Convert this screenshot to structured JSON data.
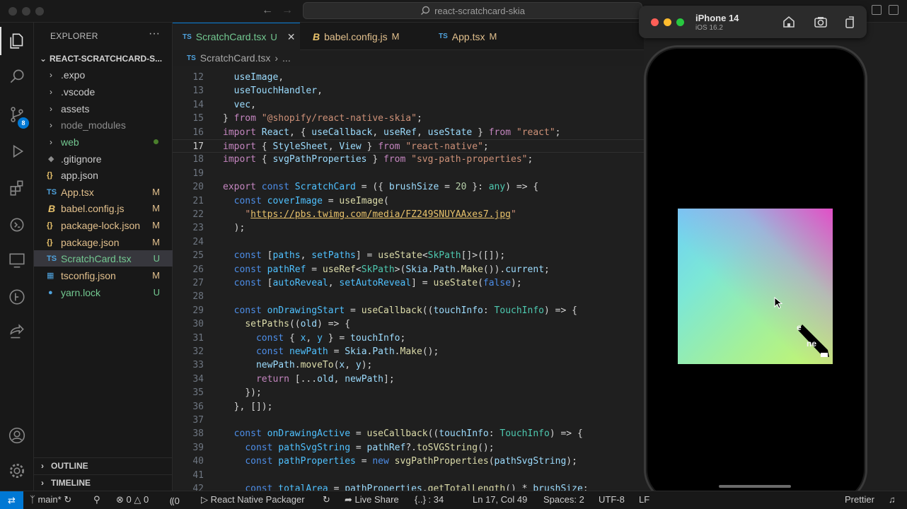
{
  "window": {
    "search_text": "react-scratchcard-skia"
  },
  "activity_bar": {
    "scm_badge": "8"
  },
  "explorer": {
    "title": "EXPLORER",
    "root": "REACT-SCRATCHCARD-S...",
    "items": [
      {
        "name": ".expo",
        "type": "folder",
        "status": ""
      },
      {
        "name": ".vscode",
        "type": "folder",
        "status": ""
      },
      {
        "name": "assets",
        "type": "folder",
        "status": ""
      },
      {
        "name": "node_modules",
        "type": "folder",
        "status": ""
      },
      {
        "name": "web",
        "type": "folder",
        "status": "dot"
      },
      {
        "name": ".gitignore",
        "type": "git",
        "status": ""
      },
      {
        "name": "app.json",
        "type": "json",
        "status": ""
      },
      {
        "name": "App.tsx",
        "type": "ts",
        "status": "M"
      },
      {
        "name": "babel.config.js",
        "type": "babel",
        "status": "M"
      },
      {
        "name": "package-lock.json",
        "type": "json",
        "status": "M"
      },
      {
        "name": "package.json",
        "type": "json",
        "status": "M"
      },
      {
        "name": "ScratchCard.tsx",
        "type": "ts",
        "status": "U"
      },
      {
        "name": "tsconfig.json",
        "type": "tsconfig",
        "status": "M"
      },
      {
        "name": "yarn.lock",
        "type": "yarn",
        "status": "U"
      }
    ],
    "outline": "OUTLINE",
    "timeline": "TIMELINE"
  },
  "tabs": [
    {
      "icon": "TS",
      "label": "ScratchCard.tsx",
      "state": "U",
      "active": true
    },
    {
      "icon": "babel",
      "label": "babel.config.js",
      "state": "M",
      "active": false
    },
    {
      "icon": "TS",
      "label": "App.tsx",
      "state": "M",
      "active": false
    }
  ],
  "breadcrumb": {
    "icon": "TS",
    "file": "ScratchCard.tsx",
    "rest": "..."
  },
  "editor": {
    "current_line": 17,
    "lines": [
      {
        "n": "12",
        "html": "  <span class='v'>useImage</span><span class='p'>,</span>"
      },
      {
        "n": "13",
        "html": "  <span class='v'>useTouchHandler</span><span class='p'>,</span>"
      },
      {
        "n": "14",
        "html": "  <span class='v'>vec</span><span class='p'>,</span>"
      },
      {
        "n": "15",
        "html": "<span class='p'>}</span> <span class='kp'>from</span> <span class='s'>\"@shopify/react-native-skia\"</span><span class='p'>;</span>"
      },
      {
        "n": "16",
        "html": "<span class='kp'>import</span> <span class='v'>React</span><span class='p'>, {</span> <span class='v'>useCallback</span><span class='p'>,</span> <span class='v'>useRef</span><span class='p'>,</span> <span class='v'>useState</span> <span class='p'>}</span> <span class='kp'>from</span> <span class='s'>\"react\"</span><span class='p'>;</span>"
      },
      {
        "n": "17",
        "html": "<span class='kp'>import</span> <span class='p'>{</span> <span class='v'>StyleSheet</span><span class='p'>,</span> <span class='v'>View</span> <span class='p'>}</span> <span class='kp'>from</span> <span class='s'>\"react-native\"</span><span class='p'>;</span>"
      },
      {
        "n": "18",
        "html": "<span class='kp'>import</span> <span class='p'>{</span> <span class='v'>svgPathProperties</span> <span class='p'>}</span> <span class='kp'>from</span> <span class='s'>\"svg-path-properties\"</span><span class='p'>;</span>"
      },
      {
        "n": "19",
        "html": ""
      },
      {
        "n": "20",
        "html": "<span class='kp'>export</span> <span class='k'>const</span> <span class='c'>ScratchCard</span> <span class='p'>= ({</span> <span class='v'>brushSize</span> <span class='p'>=</span> <span class='n'>20</span> <span class='p'>}:</span> <span class='t'>any</span><span class='p'>) =&gt; {</span>"
      },
      {
        "n": "21",
        "html": "  <span class='k'>const</span> <span class='c'>coverImage</span> <span class='p'>=</span> <span class='f'>useImage</span><span class='p'>(</span>"
      },
      {
        "n": "22",
        "html": "    <span class='s'>\"</span><span class='u'>https://pbs.twimg.com/media/FZ249SNUYAAxes7.jpg</span><span class='s'>\"</span>"
      },
      {
        "n": "23",
        "html": "  <span class='p'>);</span>"
      },
      {
        "n": "24",
        "html": ""
      },
      {
        "n": "25",
        "html": "  <span class='k'>const</span> <span class='p'>[</span><span class='c'>paths</span><span class='p'>,</span> <span class='c'>setPaths</span><span class='p'>] =</span> <span class='f'>useState</span><span class='p'>&lt;</span><span class='t'>SkPath</span><span class='p'>[]&gt;([]);</span>"
      },
      {
        "n": "26",
        "html": "  <span class='k'>const</span> <span class='c'>pathRef</span> <span class='p'>=</span> <span class='f'>useRef</span><span class='p'>&lt;</span><span class='t'>SkPath</span><span class='p'>&gt;(</span><span class='v'>Skia</span><span class='p'>.</span><span class='v'>Path</span><span class='p'>.</span><span class='f'>Make</span><span class='p'>()).</span><span class='v'>current</span><span class='p'>;</span>"
      },
      {
        "n": "27",
        "html": "  <span class='k'>const</span> <span class='p'>[</span><span class='c'>autoReveal</span><span class='p'>,</span> <span class='c'>setAutoReveal</span><span class='p'>] =</span> <span class='f'>useState</span><span class='p'>(</span><span class='k'>false</span><span class='p'>);</span>"
      },
      {
        "n": "28",
        "html": ""
      },
      {
        "n": "29",
        "html": "  <span class='k'>const</span> <span class='c'>onDrawingStart</span> <span class='p'>=</span> <span class='f'>useCallback</span><span class='p'>((</span><span class='v'>touchInfo</span><span class='p'>:</span> <span class='t'>TouchInfo</span><span class='p'>) =&gt; {</span>"
      },
      {
        "n": "30",
        "html": "    <span class='f'>setPaths</span><span class='p'>((</span><span class='v'>old</span><span class='p'>) =&gt; {</span>"
      },
      {
        "n": "31",
        "html": "      <span class='k'>const</span> <span class='p'>{</span> <span class='c'>x</span><span class='p'>,</span> <span class='c'>y</span> <span class='p'>} =</span> <span class='v'>touchInfo</span><span class='p'>;</span>"
      },
      {
        "n": "32",
        "html": "      <span class='k'>const</span> <span class='c'>newPath</span> <span class='p'>=</span> <span class='v'>Skia</span><span class='p'>.</span><span class='v'>Path</span><span class='p'>.</span><span class='f'>Make</span><span class='p'>();</span>"
      },
      {
        "n": "33",
        "html": "      <span class='v'>newPath</span><span class='p'>.</span><span class='f'>moveTo</span><span class='p'>(</span><span class='v'>x</span><span class='p'>,</span> <span class='v'>y</span><span class='p'>);</span>"
      },
      {
        "n": "34",
        "html": "      <span class='kp'>return</span> <span class='p'>[...</span><span class='v'>old</span><span class='p'>,</span> <span class='v'>newPath</span><span class='p'>];</span>"
      },
      {
        "n": "35",
        "html": "    <span class='p'>});</span>"
      },
      {
        "n": "36",
        "html": "  <span class='p'>}, []);</span>"
      },
      {
        "n": "37",
        "html": ""
      },
      {
        "n": "38",
        "html": "  <span class='k'>const</span> <span class='c'>onDrawingActive</span> <span class='p'>=</span> <span class='f'>useCallback</span><span class='p'>((</span><span class='v'>touchInfo</span><span class='p'>:</span> <span class='t'>TouchInfo</span><span class='p'>) =&gt; {</span>"
      },
      {
        "n": "39",
        "html": "    <span class='k'>const</span> <span class='c'>pathSvgString</span> <span class='p'>=</span> <span class='v'>pathRef</span><span class='p'>?.</span><span class='f'>toSVGString</span><span class='p'>();</span>"
      },
      {
        "n": "40",
        "html": "    <span class='k'>const</span> <span class='c'>pathProperties</span> <span class='p'>=</span> <span class='k'>new</span> <span class='f'>svgPathProperties</span><span class='p'>(</span><span class='v'>pathSvgString</span><span class='p'>);</span>"
      },
      {
        "n": "41",
        "html": ""
      },
      {
        "n": "42",
        "html": "    <span class='k'>const</span> <span class='c'>totalArea</span> <span class='p'>=</span> <span class='v'>pathProperties</span><span class='p'>.</span><span class='f'>getTotalLength</span><span class='p'>() *</span> <span class='v'>brushSize</span><span class='p'>;</span>"
      }
    ]
  },
  "simulator": {
    "device": "iPhone 14",
    "os": "iOS 16.2",
    "traffic_colors": [
      "#ff5f57",
      "#febc2e",
      "#28c840"
    ]
  },
  "status_bar": {
    "branch": "main*",
    "errors": "0",
    "warnings": "0",
    "ports": "0",
    "packager": "React Native Packager",
    "live_share": "Live Share",
    "braces": "{..} : 34",
    "position": "Ln 17, Col 49",
    "spaces": "Spaces: 2",
    "encoding": "UTF-8",
    "eol": "LF",
    "formatter": "Prettier"
  },
  "colors": {
    "accent": "#0078d4",
    "modified": "#e2c08d",
    "untracked": "#73c991"
  }
}
